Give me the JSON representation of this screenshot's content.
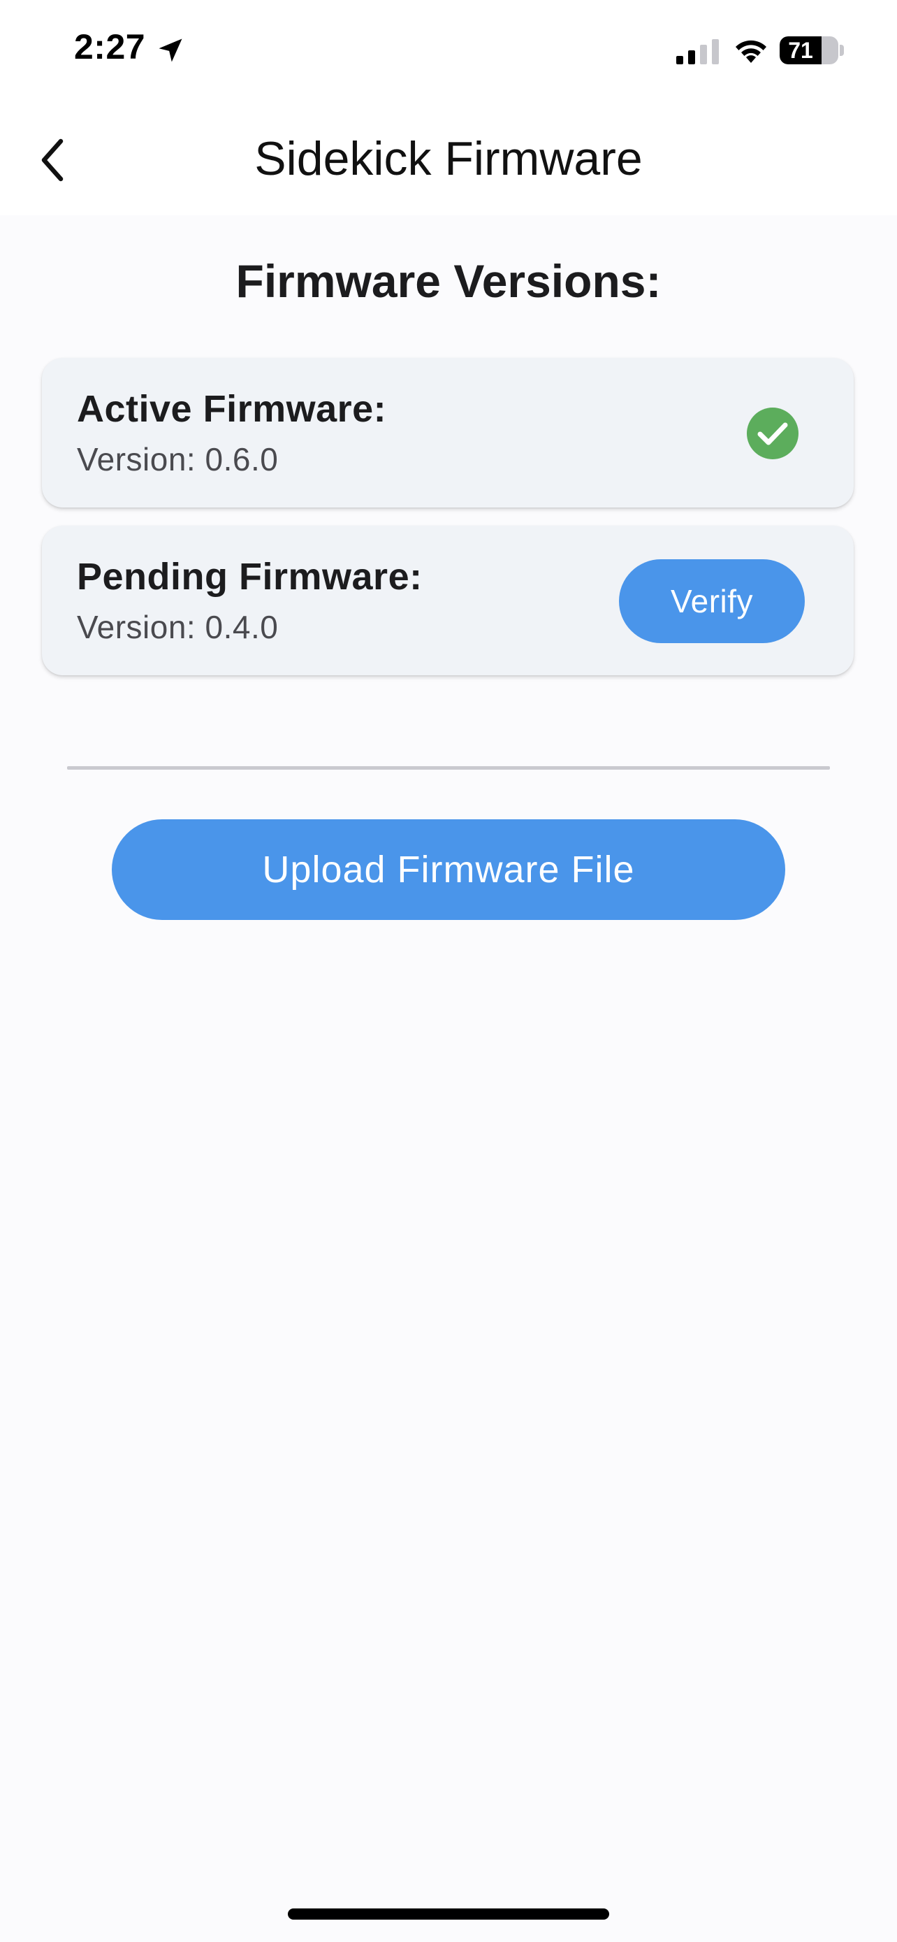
{
  "status_bar": {
    "time": "2:27",
    "battery_level": "71",
    "icons": [
      "location-arrow-icon",
      "cellular-signal-icon",
      "wifi-icon",
      "battery-icon"
    ]
  },
  "nav": {
    "back_icon": "chevron-left-icon",
    "title": "Sidekick Firmware"
  },
  "main": {
    "section_title": "Firmware Versions:",
    "active": {
      "title": "Active Firmware:",
      "version": "Version: 0.6.0",
      "status_icon": "check-circle-icon",
      "status_color": "#5cad5c"
    },
    "pending": {
      "title": "Pending Firmware:",
      "version": "Version: 0.4.0",
      "verify_label": "Verify"
    },
    "upload_label": "Upload Firmware File"
  },
  "colors": {
    "accent": "#4a95ea",
    "card_background": "#f0f3f7",
    "page_background": "#fbfbfd"
  }
}
